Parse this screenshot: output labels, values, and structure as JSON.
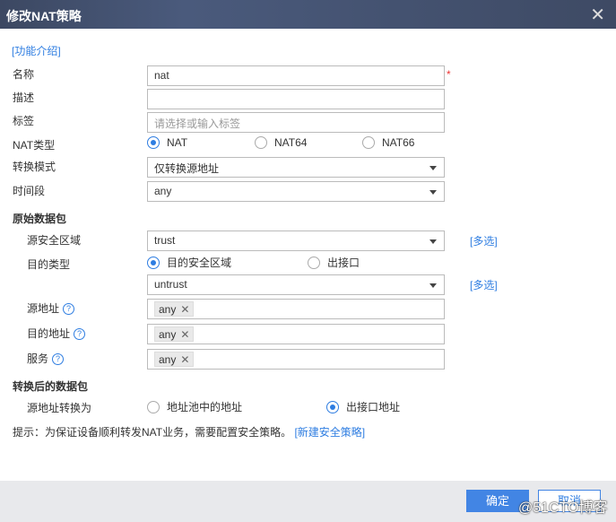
{
  "title": "修改NAT策略",
  "intro_link": "[功能介绍]",
  "fields": {
    "name": {
      "label": "名称",
      "value": "nat",
      "required": "*"
    },
    "desc": {
      "label": "描述",
      "value": ""
    },
    "tag": {
      "label": "标签",
      "placeholder": "请选择或输入标签"
    },
    "nat_type": {
      "label": "NAT类型",
      "options": [
        "NAT",
        "NAT64",
        "NAT66"
      ],
      "selected": "NAT"
    },
    "mode": {
      "label": "转换模式",
      "value": "仅转换源地址"
    },
    "time": {
      "label": "时间段",
      "value": "any"
    }
  },
  "original": {
    "heading": "原始数据包",
    "src_zone": {
      "label": "源安全区域",
      "value": "trust",
      "multi": "[多选]"
    },
    "dst_type": {
      "label": "目的类型",
      "options": [
        "目的安全区域",
        "出接口"
      ],
      "selected": "目的安全区域"
    },
    "dst_zone": {
      "value": "untrust",
      "multi": "[多选]"
    },
    "src_addr": {
      "label": "源地址",
      "tag": "any"
    },
    "dst_addr": {
      "label": "目的地址",
      "tag": "any"
    },
    "service": {
      "label": "服务",
      "tag": "any"
    }
  },
  "translated": {
    "heading": "转换后的数据包",
    "src_trans": {
      "label": "源地址转换为",
      "options": [
        "地址池中的地址",
        "出接口地址"
      ],
      "selected": "出接口地址"
    }
  },
  "hint": {
    "text": "提示：为保证设备顺利转发NAT业务，需要配置安全策略。",
    "link": "[新建安全策略]"
  },
  "buttons": {
    "ok": "确定",
    "cancel": "取消"
  },
  "watermark": "@51CTO博客",
  "colors": {
    "accent": "#4285e4",
    "titlebar": "#3e4a64"
  }
}
